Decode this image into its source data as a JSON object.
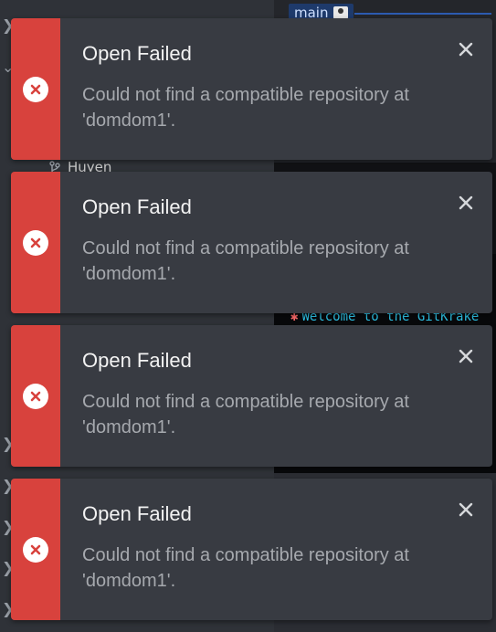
{
  "background": {
    "branch_name": "main",
    "sidebar_branch": "Huyen",
    "welcome_text": "Welcome to the GitKrake"
  },
  "toasts": [
    {
      "title": "Open Failed",
      "message": "Could not find a compatible repository at 'domdom1'."
    },
    {
      "title": "Open Failed",
      "message": "Could not find a compatible repository at 'domdom1'."
    },
    {
      "title": "Open Failed",
      "message": "Could not find a compatible repository at 'domdom1'."
    },
    {
      "title": "Open Failed",
      "message": "Could not find a compatible repository at 'domdom1'."
    }
  ],
  "colors": {
    "error_stripe": "#d8423d",
    "toast_bg": "#383b42"
  },
  "icons": {
    "error": "error-x-icon",
    "close": "close-icon"
  }
}
